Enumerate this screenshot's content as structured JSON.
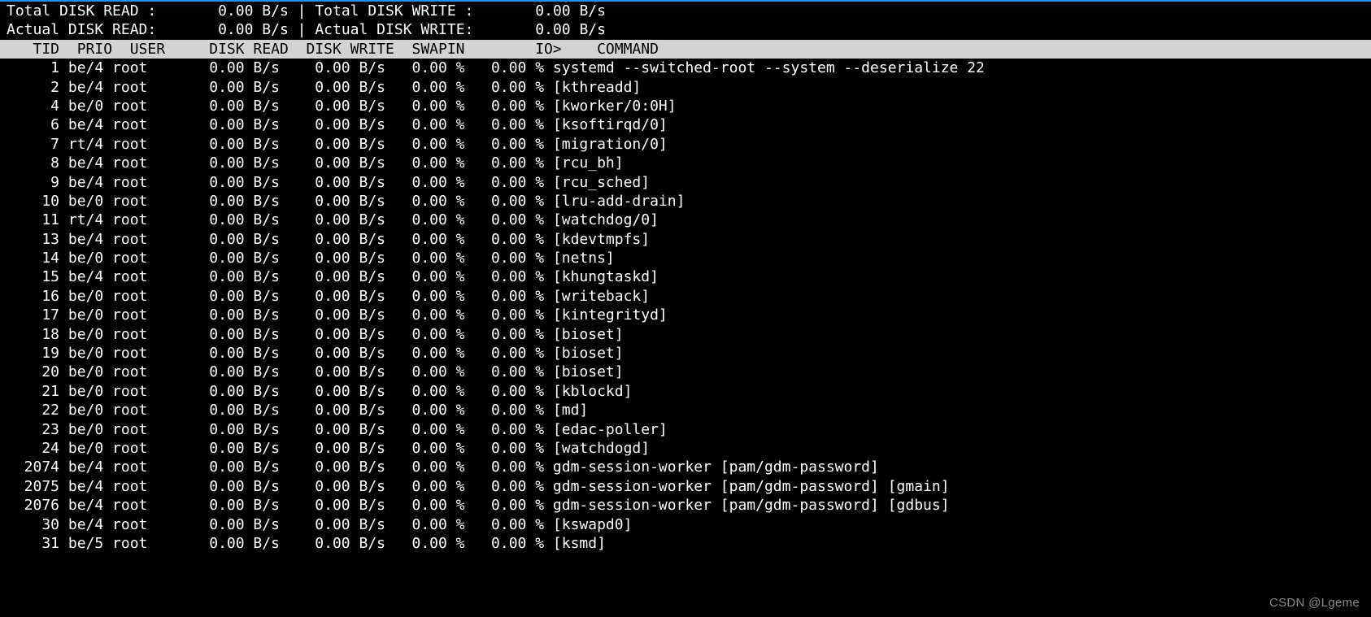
{
  "summary": {
    "total_read_label": "Total DISK READ :",
    "total_read_value": "0.00 B/s",
    "total_write_label": "Total DISK WRITE :",
    "total_write_value": "0.00 B/s",
    "actual_read_label": "Actual DISK READ:",
    "actual_read_value": "0.00 B/s",
    "actual_write_label": "Actual DISK WRITE:",
    "actual_write_value": "0.00 B/s",
    "sep": "|"
  },
  "columns": {
    "tid": "TID",
    "prio": "PRIO",
    "user": "USER",
    "disk_read": "DISK READ",
    "disk_write": "DISK WRITE",
    "swapin": "SWAPIN",
    "io": "IO>",
    "command": "COMMAND"
  },
  "rows": [
    {
      "tid": "1",
      "prio": "be/4",
      "user": "root",
      "read": "0.00 B/s",
      "write": "0.00 B/s",
      "swapin": "0.00 %",
      "io": "0.00 %",
      "cmd": "systemd --switched-root --system --deserialize 22"
    },
    {
      "tid": "2",
      "prio": "be/4",
      "user": "root",
      "read": "0.00 B/s",
      "write": "0.00 B/s",
      "swapin": "0.00 %",
      "io": "0.00 %",
      "cmd": "[kthreadd]"
    },
    {
      "tid": "4",
      "prio": "be/0",
      "user": "root",
      "read": "0.00 B/s",
      "write": "0.00 B/s",
      "swapin": "0.00 %",
      "io": "0.00 %",
      "cmd": "[kworker/0:0H]"
    },
    {
      "tid": "6",
      "prio": "be/4",
      "user": "root",
      "read": "0.00 B/s",
      "write": "0.00 B/s",
      "swapin": "0.00 %",
      "io": "0.00 %",
      "cmd": "[ksoftirqd/0]"
    },
    {
      "tid": "7",
      "prio": "rt/4",
      "user": "root",
      "read": "0.00 B/s",
      "write": "0.00 B/s",
      "swapin": "0.00 %",
      "io": "0.00 %",
      "cmd": "[migration/0]"
    },
    {
      "tid": "8",
      "prio": "be/4",
      "user": "root",
      "read": "0.00 B/s",
      "write": "0.00 B/s",
      "swapin": "0.00 %",
      "io": "0.00 %",
      "cmd": "[rcu_bh]"
    },
    {
      "tid": "9",
      "prio": "be/4",
      "user": "root",
      "read": "0.00 B/s",
      "write": "0.00 B/s",
      "swapin": "0.00 %",
      "io": "0.00 %",
      "cmd": "[rcu_sched]"
    },
    {
      "tid": "10",
      "prio": "be/0",
      "user": "root",
      "read": "0.00 B/s",
      "write": "0.00 B/s",
      "swapin": "0.00 %",
      "io": "0.00 %",
      "cmd": "[lru-add-drain]"
    },
    {
      "tid": "11",
      "prio": "rt/4",
      "user": "root",
      "read": "0.00 B/s",
      "write": "0.00 B/s",
      "swapin": "0.00 %",
      "io": "0.00 %",
      "cmd": "[watchdog/0]"
    },
    {
      "tid": "13",
      "prio": "be/4",
      "user": "root",
      "read": "0.00 B/s",
      "write": "0.00 B/s",
      "swapin": "0.00 %",
      "io": "0.00 %",
      "cmd": "[kdevtmpfs]"
    },
    {
      "tid": "14",
      "prio": "be/0",
      "user": "root",
      "read": "0.00 B/s",
      "write": "0.00 B/s",
      "swapin": "0.00 %",
      "io": "0.00 %",
      "cmd": "[netns]"
    },
    {
      "tid": "15",
      "prio": "be/4",
      "user": "root",
      "read": "0.00 B/s",
      "write": "0.00 B/s",
      "swapin": "0.00 %",
      "io": "0.00 %",
      "cmd": "[khungtaskd]"
    },
    {
      "tid": "16",
      "prio": "be/0",
      "user": "root",
      "read": "0.00 B/s",
      "write": "0.00 B/s",
      "swapin": "0.00 %",
      "io": "0.00 %",
      "cmd": "[writeback]"
    },
    {
      "tid": "17",
      "prio": "be/0",
      "user": "root",
      "read": "0.00 B/s",
      "write": "0.00 B/s",
      "swapin": "0.00 %",
      "io": "0.00 %",
      "cmd": "[kintegrityd]"
    },
    {
      "tid": "18",
      "prio": "be/0",
      "user": "root",
      "read": "0.00 B/s",
      "write": "0.00 B/s",
      "swapin": "0.00 %",
      "io": "0.00 %",
      "cmd": "[bioset]"
    },
    {
      "tid": "19",
      "prio": "be/0",
      "user": "root",
      "read": "0.00 B/s",
      "write": "0.00 B/s",
      "swapin": "0.00 %",
      "io": "0.00 %",
      "cmd": "[bioset]"
    },
    {
      "tid": "20",
      "prio": "be/0",
      "user": "root",
      "read": "0.00 B/s",
      "write": "0.00 B/s",
      "swapin": "0.00 %",
      "io": "0.00 %",
      "cmd": "[bioset]"
    },
    {
      "tid": "21",
      "prio": "be/0",
      "user": "root",
      "read": "0.00 B/s",
      "write": "0.00 B/s",
      "swapin": "0.00 %",
      "io": "0.00 %",
      "cmd": "[kblockd]"
    },
    {
      "tid": "22",
      "prio": "be/0",
      "user": "root",
      "read": "0.00 B/s",
      "write": "0.00 B/s",
      "swapin": "0.00 %",
      "io": "0.00 %",
      "cmd": "[md]"
    },
    {
      "tid": "23",
      "prio": "be/0",
      "user": "root",
      "read": "0.00 B/s",
      "write": "0.00 B/s",
      "swapin": "0.00 %",
      "io": "0.00 %",
      "cmd": "[edac-poller]"
    },
    {
      "tid": "24",
      "prio": "be/0",
      "user": "root",
      "read": "0.00 B/s",
      "write": "0.00 B/s",
      "swapin": "0.00 %",
      "io": "0.00 %",
      "cmd": "[watchdogd]"
    },
    {
      "tid": "2074",
      "prio": "be/4",
      "user": "root",
      "read": "0.00 B/s",
      "write": "0.00 B/s",
      "swapin": "0.00 %",
      "io": "0.00 %",
      "cmd": "gdm-session-worker [pam/gdm-password]"
    },
    {
      "tid": "2075",
      "prio": "be/4",
      "user": "root",
      "read": "0.00 B/s",
      "write": "0.00 B/s",
      "swapin": "0.00 %",
      "io": "0.00 %",
      "cmd": "gdm-session-worker [pam/gdm-password] [gmain]"
    },
    {
      "tid": "2076",
      "prio": "be/4",
      "user": "root",
      "read": "0.00 B/s",
      "write": "0.00 B/s",
      "swapin": "0.00 %",
      "io": "0.00 %",
      "cmd": "gdm-session-worker [pam/gdm-password] [gdbus]"
    },
    {
      "tid": "30",
      "prio": "be/4",
      "user": "root",
      "read": "0.00 B/s",
      "write": "0.00 B/s",
      "swapin": "0.00 %",
      "io": "0.00 %",
      "cmd": "[kswapd0]"
    },
    {
      "tid": "31",
      "prio": "be/5",
      "user": "root",
      "read": "0.00 B/s",
      "write": "0.00 B/s",
      "swapin": "0.00 %",
      "io": "0.00 %",
      "cmd": "[ksmd]"
    }
  ],
  "watermark": "CSDN @Lgeme"
}
